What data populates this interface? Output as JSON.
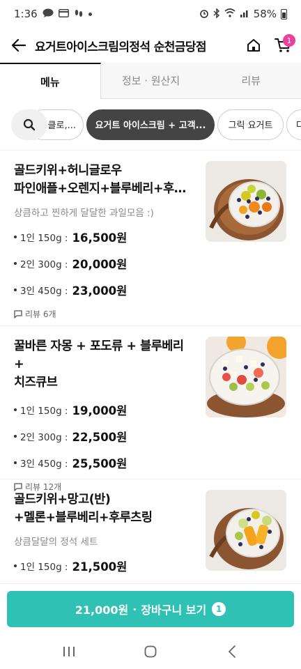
{
  "status_bar": {
    "time": "1:36",
    "battery": "58%"
  },
  "header": {
    "title": "요거트아이스크림의정석 순천금당점",
    "cart_badge": "1"
  },
  "tabs": [
    {
      "label": "메뉴",
      "active": true
    },
    {
      "label": "정보 · 원산지",
      "active": false
    },
    {
      "label": "리뷰",
      "active": false
    }
  ],
  "categories": [
    {
      "label": "클로,...",
      "active": false
    },
    {
      "label": "요거트 아이스크림 + 고객...",
      "active": true
    },
    {
      "label": "그릭 요거트",
      "active": false
    },
    {
      "label": "다",
      "active": false
    }
  ],
  "menu_items": [
    {
      "name_line1": "골드키위+허니글로우",
      "name_line2": "파인애플+오렌지+블루베리+후루...",
      "description": "상큼하고 찐하게  달달한 과일모음 :)",
      "prices": [
        {
          "label": "1인 150g :",
          "amount": "16,500원"
        },
        {
          "label": "2인 300g :",
          "amount": "20,000원"
        },
        {
          "label": "3인 450g :",
          "amount": "23,000원"
        }
      ],
      "review": "리뷰 6개"
    },
    {
      "name_line1": "꿀바른 자몽 + 포도류 + 블루베리 +",
      "name_line2": "치즈큐브",
      "description": "",
      "prices": [
        {
          "label": "1인 150g :",
          "amount": "19,000원"
        },
        {
          "label": "2인 300g :",
          "amount": "22,500원"
        },
        {
          "label": "3인 450g :",
          "amount": "25,500원"
        }
      ],
      "review": "리뷰 12개"
    },
    {
      "name_line1": "골드키위+망고(반)",
      "name_line2": "+멜론+블루베리+후루츠링",
      "description": "상큼달달의 정석 세트",
      "prices": [
        {
          "label": "1인 150g :",
          "amount": "21,500원"
        }
      ],
      "review": ""
    }
  ],
  "cart_bar": {
    "total": "21,000원",
    "separator": "·",
    "label": "장바구니 보기",
    "count": "1"
  },
  "colors": {
    "accent": "#2ec1b4",
    "badge": "#e8409b",
    "chip_active": "#444444"
  }
}
